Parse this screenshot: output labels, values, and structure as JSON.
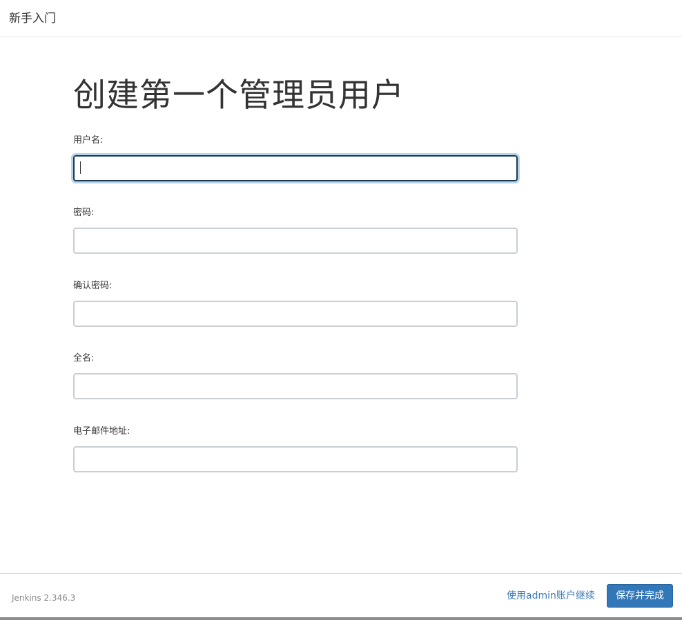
{
  "header": {
    "title": "新手入门"
  },
  "main": {
    "title": "创建第一个管理员用户",
    "fields": [
      {
        "label": "用户名:",
        "value": "",
        "focused": true
      },
      {
        "label": "密码:",
        "value": ""
      },
      {
        "label": "确认密码:",
        "value": ""
      },
      {
        "label": "全名:",
        "value": ""
      },
      {
        "label": "电子邮件地址:",
        "value": ""
      }
    ]
  },
  "footer": {
    "version": "Jenkins 2.346.3",
    "continue_link": "使用admin账户继续",
    "save_button": "保存并完成"
  },
  "colors": {
    "primary_button": "#3277b8",
    "link": "#3d7ab5",
    "focus_border": "#1a3a52"
  }
}
